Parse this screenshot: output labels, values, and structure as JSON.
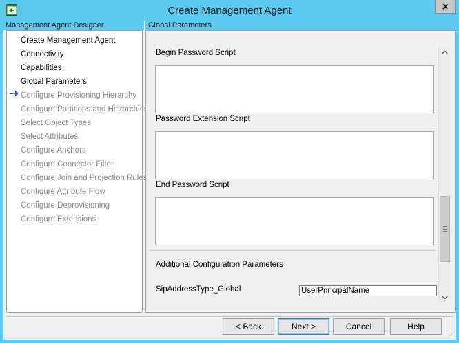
{
  "window": {
    "title": "Create Management Agent",
    "close_glyph": "✕"
  },
  "left": {
    "header": "Management Agent Designer",
    "current_indicator_icon": "arrow-right-icon",
    "items": [
      {
        "label": "Create Management Agent",
        "enabled": true
      },
      {
        "label": "Connectivity",
        "enabled": true
      },
      {
        "label": "Capabilities",
        "enabled": true
      },
      {
        "label": "Global Parameters",
        "enabled": true,
        "current": true
      },
      {
        "label": "Configure Provisioning Hierarchy",
        "enabled": false
      },
      {
        "label": "Configure Partitions and Hierarchies",
        "enabled": false
      },
      {
        "label": "Select Object Types",
        "enabled": false
      },
      {
        "label": "Select Attributes",
        "enabled": false
      },
      {
        "label": "Configure Anchors",
        "enabled": false
      },
      {
        "label": "Configure Connector Filter",
        "enabled": false
      },
      {
        "label": "Configure Join and Projection Rules",
        "enabled": false
      },
      {
        "label": "Configure Attribute Flow",
        "enabled": false
      },
      {
        "label": "Configure Deprovisioning",
        "enabled": false
      },
      {
        "label": "Configure Extensions",
        "enabled": false
      }
    ]
  },
  "right": {
    "header": "Global Parameters",
    "begin_password_script_label": "Begin Password Script",
    "begin_password_script_value": "",
    "password_extension_script_label": "Password Extension Script",
    "password_extension_script_value": "",
    "end_password_script_label": "End Password Script",
    "end_password_script_value": "",
    "additional_params_label": "Additional Configuration Parameters",
    "sip_address_type_label": "SipAddressType_Global",
    "sip_address_type_value": "UserPrincipalName"
  },
  "buttons": {
    "back": "< Back",
    "next": "Next >",
    "cancel": "Cancel",
    "help": "Help"
  }
}
